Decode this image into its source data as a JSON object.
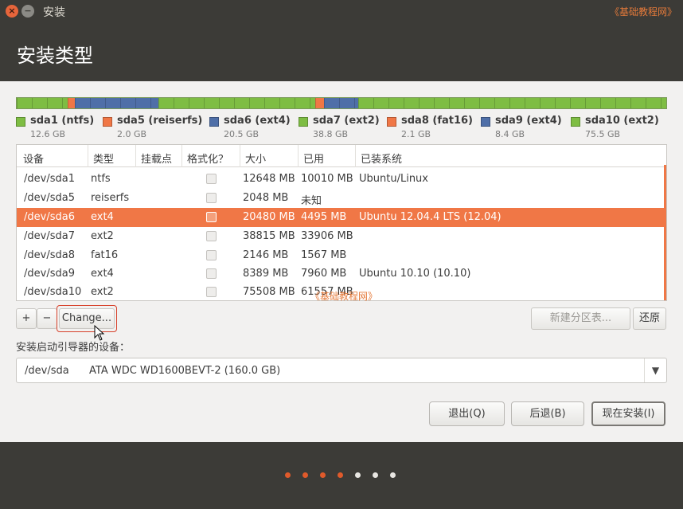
{
  "window": {
    "title": "安装",
    "watermark": "《基础教程网》",
    "close_glyph": "×",
    "minimize_glyph": "−"
  },
  "header": {
    "title": "安装类型"
  },
  "partition_bar": {
    "segments": [
      {
        "color": "#7ebd43",
        "fraction": 0.078
      },
      {
        "color": "#f07746",
        "fraction": 0.012
      },
      {
        "color": "#4f6fa8",
        "fraction": 0.128
      },
      {
        "color": "#7ebd43",
        "fraction": 0.242
      },
      {
        "color": "#f07746",
        "fraction": 0.013
      },
      {
        "color": "#4f6fa8",
        "fraction": 0.053
      },
      {
        "color": "#7ebd43",
        "fraction": 0.474
      }
    ]
  },
  "legend": [
    {
      "name": "sda1 (ntfs)",
      "size": "12.6 GB",
      "color": "#7ebd43"
    },
    {
      "name": "sda5 (reiserfs)",
      "size": "2.0 GB",
      "color": "#f07746"
    },
    {
      "name": "sda6 (ext4)",
      "size": "20.5 GB",
      "color": "#4f6fa8"
    },
    {
      "name": "sda7 (ext2)",
      "size": "38.8 GB",
      "color": "#7ebd43"
    },
    {
      "name": "sda8 (fat16)",
      "size": "2.1 GB",
      "color": "#f07746"
    },
    {
      "name": "sda9 (ext4)",
      "size": "8.4 GB",
      "color": "#4f6fa8"
    },
    {
      "name": "sda10 (ext2)",
      "size": "75.5 GB",
      "color": "#7ebd43"
    }
  ],
  "table": {
    "columns": [
      "设备",
      "类型",
      "挂载点",
      "格式化？",
      "大小",
      "已用",
      "已装系统"
    ],
    "rows": [
      {
        "device": "/dev/sda1",
        "type": "ntfs",
        "mount": "",
        "size": "12648 MB",
        "used": "10010 MB",
        "os": "Ubuntu/Linux",
        "selected": false
      },
      {
        "device": "/dev/sda5",
        "type": "reiserfs",
        "mount": "",
        "size": "2048 MB",
        "used": "未知",
        "os": "",
        "selected": false
      },
      {
        "device": "/dev/sda6",
        "type": "ext4",
        "mount": "",
        "size": "20480 MB",
        "used": "4495 MB",
        "os": "Ubuntu 12.04.4 LTS (12.04)",
        "selected": true
      },
      {
        "device": "/dev/sda7",
        "type": "ext2",
        "mount": "",
        "size": "38815 MB",
        "used": "33906 MB",
        "os": "",
        "selected": false
      },
      {
        "device": "/dev/sda8",
        "type": "fat16",
        "mount": "",
        "size": "2146 MB",
        "used": "1567 MB",
        "os": "",
        "selected": false
      },
      {
        "device": "/dev/sda9",
        "type": "ext4",
        "mount": "",
        "size": "8389 MB",
        "used": "7960 MB",
        "os": "Ubuntu 10.10 (10.10)",
        "selected": false
      },
      {
        "device": "/dev/sda10",
        "type": "ext2",
        "mount": "",
        "size": "75508 MB",
        "used": "61557 MB",
        "os": "",
        "selected": false
      }
    ]
  },
  "toolbar": {
    "add_label": "+",
    "remove_label": "−",
    "change_label": "Change...",
    "new_table_label": "新建分区表...",
    "revert_label": "还原"
  },
  "bootloader": {
    "label": "安装启动引导器的设备：",
    "device": "/dev/sda",
    "model": "ATA WDC WD1600BEVT-2 (160.0 GB)",
    "arrow": "▼"
  },
  "actions": {
    "quit_label": "退出(Q)",
    "back_label": "后退(B)",
    "install_label": "现在安装(I)"
  },
  "progress": {
    "total_steps": 7,
    "completed_steps": 4,
    "active_color": "#e05a2b",
    "inactive_color": "#e8e6e2"
  }
}
